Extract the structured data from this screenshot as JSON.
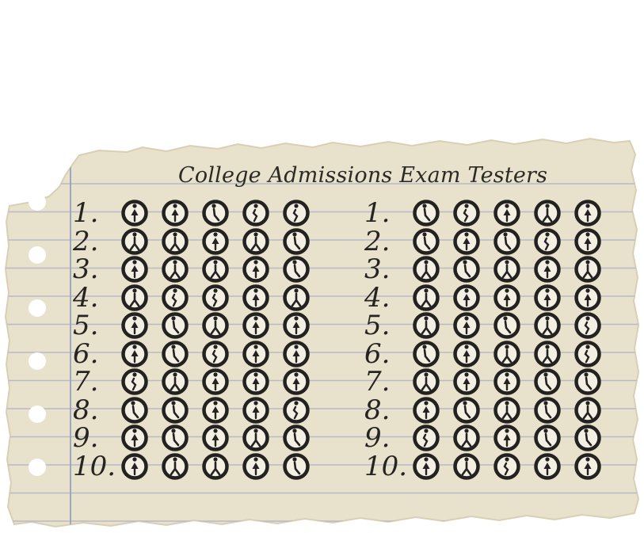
{
  "title": "College Admissions Exam Testers",
  "colors": {
    "paper": "#e8e1cb",
    "rule_line": "#b9b9c6",
    "margin_line": "#9ea6c0",
    "ink": "#232220",
    "bubble_fill": "#f3efe3"
  },
  "left_column": {
    "rows": [
      {
        "label": "1.",
        "figures": [
          "arms-up",
          "arms-up",
          "hunched",
          "bent",
          "bent"
        ]
      },
      {
        "label": "2.",
        "figures": [
          "walking",
          "walking",
          "arms-up",
          "walking",
          "hunched"
        ]
      },
      {
        "label": "3.",
        "figures": [
          "arms-up",
          "walking",
          "walking",
          "arms-up",
          "hunched"
        ]
      },
      {
        "label": "4.",
        "figures": [
          "walking",
          "bent",
          "bent",
          "arms-up",
          "walking"
        ]
      },
      {
        "label": "5.",
        "figures": [
          "arms-up",
          "hunched",
          "walking",
          "arms-up",
          "arms-up"
        ]
      },
      {
        "label": "6.",
        "figures": [
          "arms-up",
          "hunched",
          "bent",
          "arms-up",
          "arms-up"
        ]
      },
      {
        "label": "7.",
        "figures": [
          "bent",
          "walking",
          "arms-up",
          "arms-up",
          "arms-up"
        ]
      },
      {
        "label": "8.",
        "figures": [
          "hunched",
          "hunched",
          "arms-up",
          "arms-up",
          "bent"
        ]
      },
      {
        "label": "9.",
        "figures": [
          "arms-up",
          "hunched",
          "arms-up",
          "walking",
          "hunched"
        ]
      },
      {
        "label": "10.",
        "figures": [
          "arms-up",
          "walking",
          "walking",
          "arms-up",
          "hunched"
        ]
      }
    ]
  },
  "right_column": {
    "rows": [
      {
        "label": "1.",
        "figures": [
          "hunched",
          "bent",
          "arms-up",
          "walking",
          "arms-up"
        ]
      },
      {
        "label": "2.",
        "figures": [
          "hunched",
          "arms-up",
          "hunched",
          "bent",
          "arms-up"
        ]
      },
      {
        "label": "3.",
        "figures": [
          "walking",
          "hunched",
          "walking",
          "arms-up",
          "walking"
        ]
      },
      {
        "label": "4.",
        "figures": [
          "walking",
          "arms-up",
          "arms-up",
          "arms-up",
          "arms-up"
        ]
      },
      {
        "label": "5.",
        "figures": [
          "walking",
          "arms-up",
          "hunched",
          "walking",
          "bent"
        ]
      },
      {
        "label": "6.",
        "figures": [
          "hunched",
          "arms-up",
          "walking",
          "walking",
          "bent"
        ]
      },
      {
        "label": "7.",
        "figures": [
          "walking",
          "arms-up",
          "arms-up",
          "hunched",
          "hunched"
        ]
      },
      {
        "label": "8.",
        "figures": [
          "arms-up",
          "hunched",
          "walking",
          "hunched",
          "walking"
        ]
      },
      {
        "label": "9.",
        "figures": [
          "bent",
          "walking",
          "arms-up",
          "hunched",
          "hunched"
        ]
      },
      {
        "label": "10.",
        "figures": [
          "arms-up",
          "walking",
          "bent",
          "arms-up",
          "arms-up"
        ]
      }
    ]
  }
}
